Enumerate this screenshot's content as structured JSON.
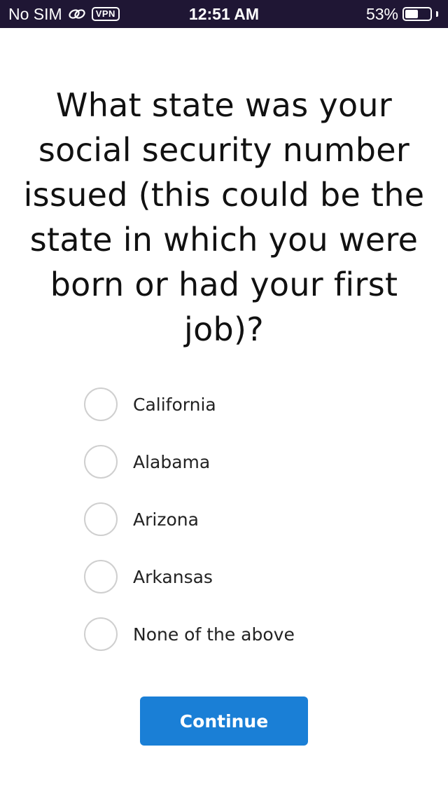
{
  "status_bar": {
    "carrier": "No SIM",
    "vpn_label": "VPN",
    "time": "12:51 AM",
    "battery_percent_text": "53%",
    "battery_level": 0.53,
    "icons": [
      "link-icon",
      "vpn-icon",
      "battery-icon"
    ]
  },
  "question": {
    "text": "What state was your social security number issued (this could be the state in which you were born or had your first job)?"
  },
  "options": [
    {
      "label": "California",
      "selected": false
    },
    {
      "label": "Alabama",
      "selected": false
    },
    {
      "label": "Arizona",
      "selected": false
    },
    {
      "label": "Arkansas",
      "selected": false
    },
    {
      "label": "None of the above",
      "selected": false
    }
  ],
  "continue_button": {
    "label": "Continue"
  },
  "colors": {
    "status_bar_bg": "#1f1634",
    "button_bg": "#1a7fd6",
    "radio_border": "#cfcfcf"
  }
}
